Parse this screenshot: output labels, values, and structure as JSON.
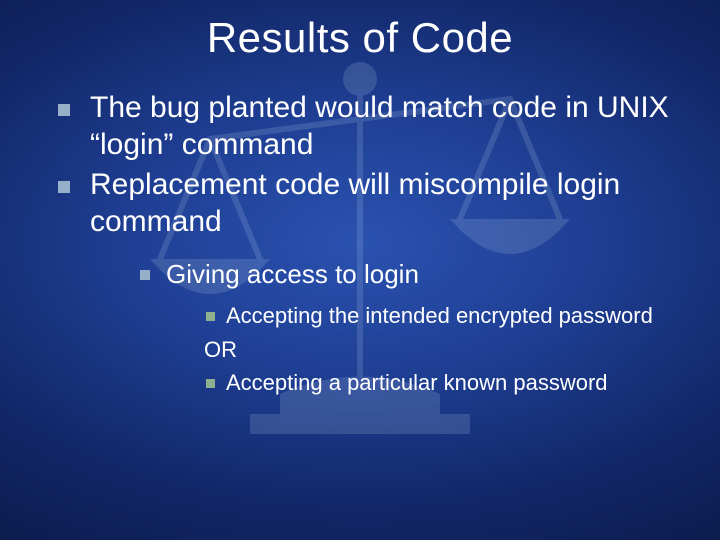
{
  "title": "Results of Code",
  "bullets": {
    "b1": "The bug planted would match code in UNIX “login” command",
    "b2": "Replacement code will miscompile login command",
    "b2_1": "Giving access to login",
    "b2_1_a": "Accepting the intended encrypted password",
    "b2_1_or": "OR",
    "b2_1_b": "Accepting a particular known password"
  },
  "colors": {
    "bullet_square": "#96b0ca",
    "sub_square": "#8eb08e"
  }
}
